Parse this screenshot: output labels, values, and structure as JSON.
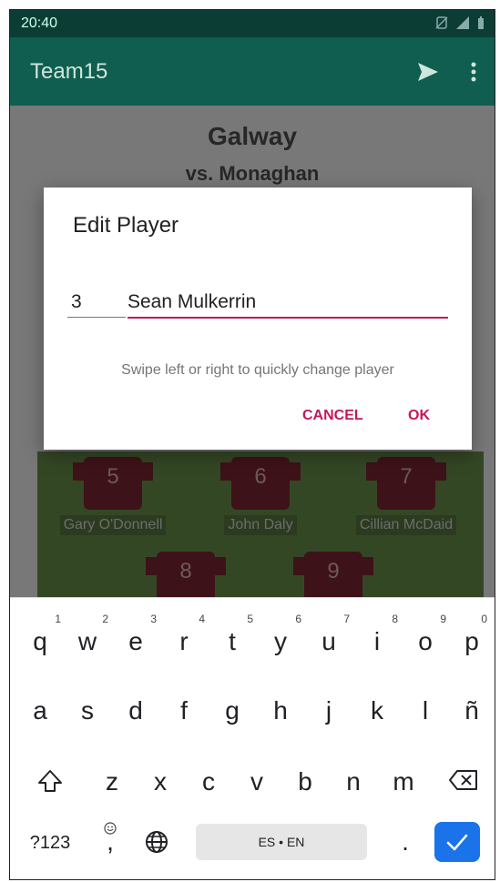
{
  "status": {
    "time": "20:40"
  },
  "appbar": {
    "title": "Team15",
    "send_icon": "send-icon",
    "menu_icon": "more-vert-icon"
  },
  "match": {
    "team": "Galway",
    "opponent": "vs. Monaghan"
  },
  "players": [
    {
      "number": "5",
      "name": "Gary O'Donnell"
    },
    {
      "number": "6",
      "name": "John Daly"
    },
    {
      "number": "7",
      "name": "Cillian McDaid"
    },
    {
      "number": "8",
      "name": ""
    },
    {
      "number": "9",
      "name": ""
    }
  ],
  "dialog": {
    "title": "Edit Player",
    "number_value": "3",
    "name_value": "Sean Mulkerrin",
    "hint": "Swipe left or right to quickly change player",
    "cancel_label": "CANCEL",
    "ok_label": "OK"
  },
  "keyboard": {
    "row1": [
      "q",
      "w",
      "e",
      "r",
      "t",
      "y",
      "u",
      "i",
      "o",
      "p"
    ],
    "row1_sup": [
      "1",
      "2",
      "3",
      "4",
      "5",
      "6",
      "7",
      "8",
      "9",
      "0"
    ],
    "row2": [
      "a",
      "s",
      "d",
      "f",
      "g",
      "h",
      "j",
      "k",
      "l",
      "ñ"
    ],
    "row3": [
      "z",
      "x",
      "c",
      "v",
      "b",
      "n",
      "m"
    ],
    "symbols_label": "?123",
    "comma_label": ",",
    "space_label": "ES • EN",
    "period_label": "."
  },
  "colors": {
    "accent": "#c2185b",
    "appbar": "#0f5e4f",
    "statusbar": "#0b3d34",
    "enter_key": "#1a73e8",
    "jersey": "#6b1f2b"
  }
}
